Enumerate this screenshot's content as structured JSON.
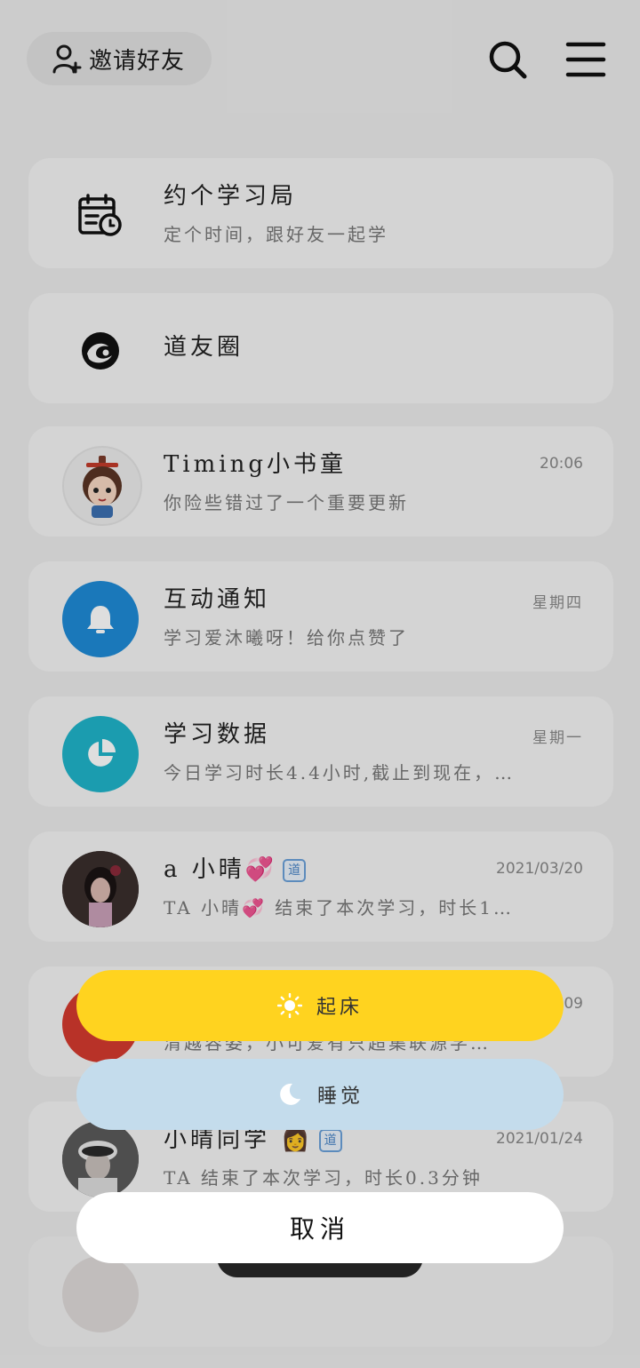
{
  "header": {
    "invite_label": "邀请好友"
  },
  "list": [
    {
      "title": "约个学习局",
      "subtitle": "定个时间，跟好友一起学",
      "time": "",
      "icon": "calendar-clock-icon"
    },
    {
      "title": "道友圈",
      "subtitle": "",
      "time": "",
      "icon": "yin-yang-icon"
    },
    {
      "title": "Timing小书童",
      "subtitle": "你险些错过了一个重要更新",
      "time": "20:06",
      "icon": "scholar-avatar"
    },
    {
      "title": "互动通知",
      "subtitle": "学习爱沐曦呀！给你点赞了",
      "time": "星期四",
      "icon": "bell-icon"
    },
    {
      "title": "学习数据",
      "subtitle": "今日学习时长4.4小时,截止到现在，…",
      "time": "星期一",
      "icon": "pie-chart-icon"
    },
    {
      "title": "a 小晴💞",
      "subtitle": "TA 小晴💞 结束了本次学习，时长1…",
      "time": "2021/03/20",
      "icon": "user-avatar",
      "badge": "道"
    },
    {
      "title": "",
      "subtitle": "清越容姿，小可爱有只超集联源学…",
      "time": "09",
      "icon": "red-avatar"
    },
    {
      "title": "小晴同学 👩",
      "subtitle": "TA 结束了本次学习，时长0.3分钟",
      "time": "2021/01/24",
      "icon": "user-avatar",
      "badge": "道"
    }
  ],
  "sheet": {
    "wake_label": "起床",
    "sleep_label": "睡觉",
    "cancel_label": "取消"
  },
  "colors": {
    "wake": "#ffd31f",
    "sleep": "#c4dcec",
    "bell_blue": "#1e8ad6",
    "chart_cyan": "#1fb4c9"
  }
}
